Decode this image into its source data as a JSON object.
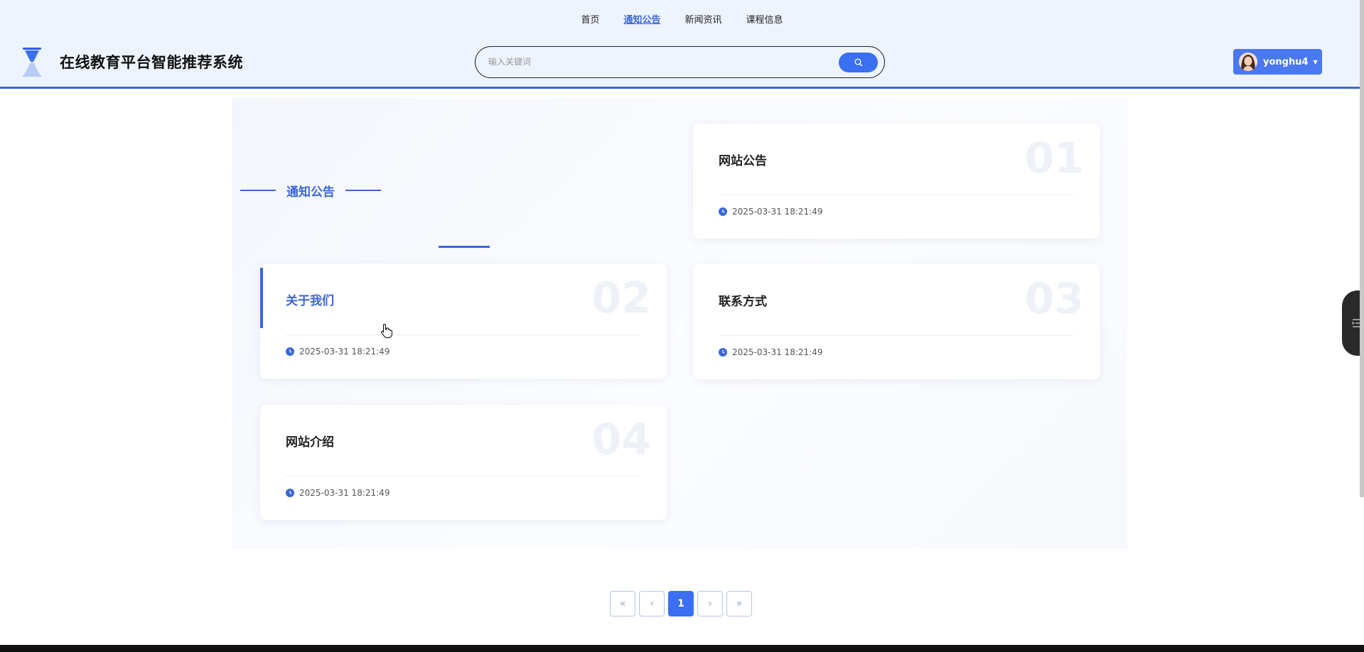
{
  "nav": {
    "items": [
      "首页",
      "通知公告",
      "新闻资讯",
      "课程信息"
    ],
    "active_index": 1
  },
  "header": {
    "site_title": "在线教育平台智能推荐系统",
    "search_placeholder": "输入关键词",
    "username": "yonghu4"
  },
  "section": {
    "title": "通知公告"
  },
  "cards": [
    {
      "num": "01",
      "title": "网站公告",
      "date": "2025-03-31 18:21:49"
    },
    {
      "num": "02",
      "title": "关于我们",
      "date": "2025-03-31 18:21:49"
    },
    {
      "num": "03",
      "title": "联系方式",
      "date": "2025-03-31 18:21:49"
    },
    {
      "num": "04",
      "title": "网站介绍",
      "date": "2025-03-31 18:21:49"
    }
  ],
  "pagination": {
    "first": "«",
    "prev": "‹",
    "current": "1",
    "next": "›",
    "last": "»"
  },
  "colors": {
    "accent": "#3b66d8",
    "button": "#3a6ff2",
    "header_bg": "#eef4fd"
  }
}
